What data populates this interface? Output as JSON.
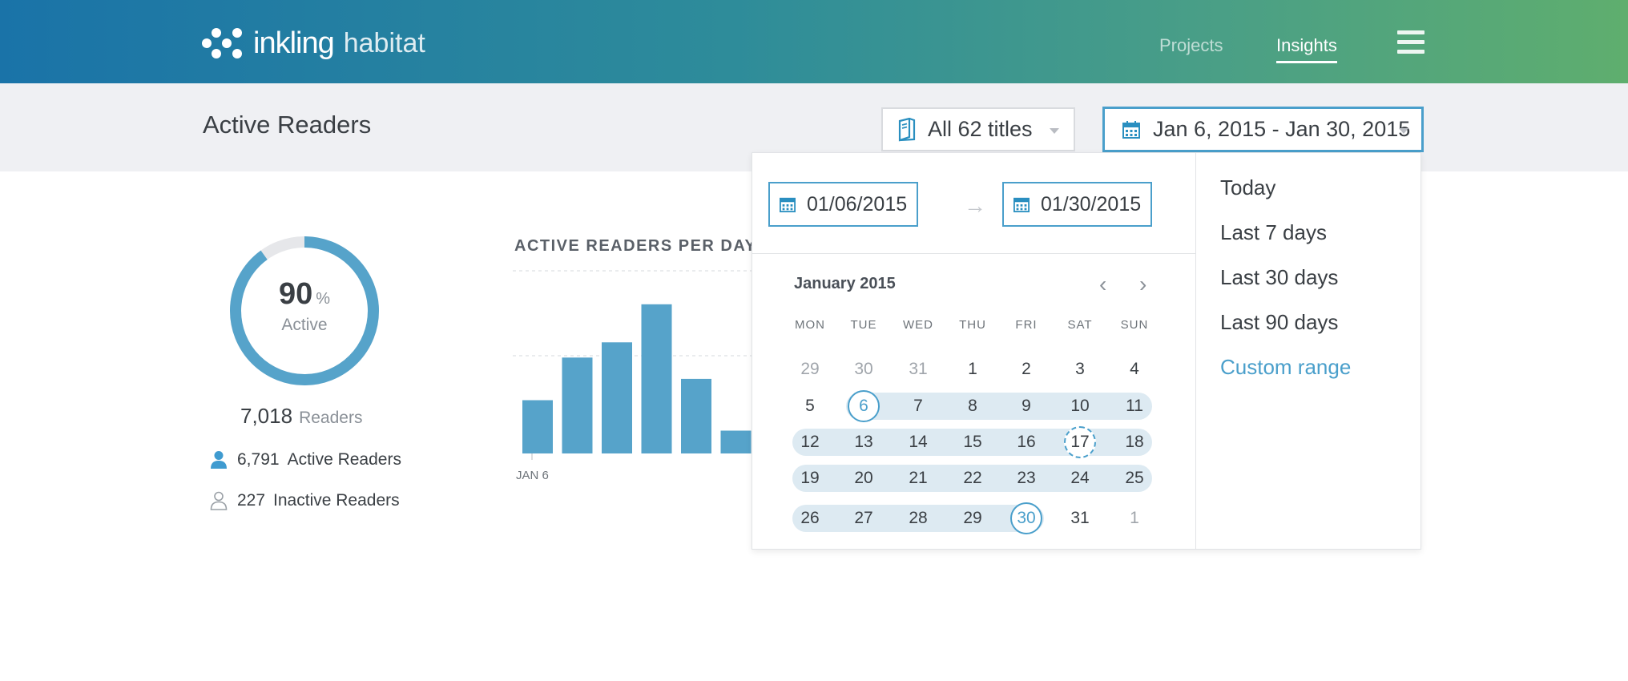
{
  "header": {
    "brand_primary": "inkling",
    "brand_secondary": "habitat",
    "nav": [
      {
        "label": "Projects"
      },
      {
        "label": "Insights"
      }
    ],
    "menu_icon": "hamburger-icon"
  },
  "toolbar": {
    "page_title": "Active Readers",
    "titles_filter": "All 62 titles",
    "date_range": "Jan 6, 2015 - Jan 30, 2015"
  },
  "summary": {
    "percent_active": "90",
    "percent_sign": "%",
    "percent_label": "Active",
    "percent_value": 0.9,
    "total_readers": "7,018",
    "total_label": "Readers",
    "active_count": "6,791",
    "active_label": "Active Readers",
    "inactive_count": "227",
    "inactive_label": "Inactive Readers"
  },
  "chart": {
    "title": "ACTIVE READERS PER DAY",
    "x_tick": "JAN 6"
  },
  "chart_data": {
    "type": "bar",
    "title": "ACTIVE READERS PER DAY",
    "categories": [
      "JAN 6",
      "",
      "",
      "",
      "",
      ""
    ],
    "values": [
      35,
      63,
      73,
      98,
      49,
      15
    ],
    "ylim": [
      0,
      120
    ],
    "grid": true
  },
  "picker": {
    "start_date": "01/06/2015",
    "end_date": "01/30/2015",
    "arrow": "→",
    "month": "January 2015",
    "prev": "‹",
    "next": "›",
    "weekdays": [
      "MON",
      "TUE",
      "WED",
      "THU",
      "FRI",
      "SAT",
      "SUN"
    ],
    "weeks": [
      [
        "29",
        "30",
        "31",
        "1",
        "2",
        "3",
        "4"
      ],
      [
        "5",
        "6",
        "7",
        "8",
        "9",
        "10",
        "11"
      ],
      [
        "12",
        "13",
        "14",
        "15",
        "16",
        "17",
        "18"
      ],
      [
        "19",
        "20",
        "21",
        "22",
        "23",
        "24",
        "25"
      ],
      [
        "26",
        "27",
        "28",
        "29",
        "30",
        "31",
        "1"
      ]
    ],
    "presets": [
      "Today",
      "Last 7 days",
      "Last 30 days",
      "Last 90 days",
      "Custom range"
    ],
    "active_preset": "Custom range"
  },
  "colors": {
    "accent": "#4a9fcb",
    "bar": "#56a3ca",
    "range_band": "#ddeaf2"
  }
}
